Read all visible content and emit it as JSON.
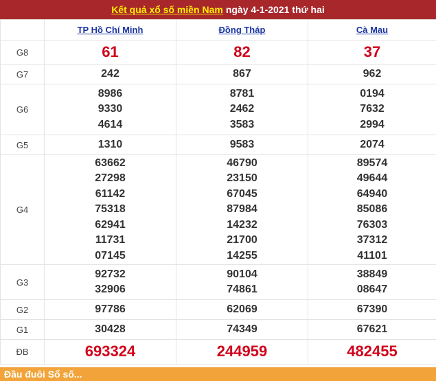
{
  "header": {
    "link": "Kết quả xổ số miền Nam",
    "date_text": "ngày 4-1-2021 thứ hai"
  },
  "provinces": [
    "TP Hồ Chí Minh",
    "Đồng Tháp",
    "Cà Mau"
  ],
  "prizes": [
    {
      "label": "G8",
      "values": [
        [
          "61"
        ],
        [
          "82"
        ],
        [
          "37"
        ]
      ]
    },
    {
      "label": "G7",
      "values": [
        [
          "242"
        ],
        [
          "867"
        ],
        [
          "962"
        ]
      ]
    },
    {
      "label": "G6",
      "values": [
        [
          "8986",
          "9330",
          "4614"
        ],
        [
          "8781",
          "2462",
          "3583"
        ],
        [
          "0194",
          "7632",
          "2994"
        ]
      ]
    },
    {
      "label": "G5",
      "values": [
        [
          "1310"
        ],
        [
          "9583"
        ],
        [
          "2074"
        ]
      ]
    },
    {
      "label": "G4",
      "values": [
        [
          "63662",
          "27298",
          "61142",
          "75318",
          "62941",
          "11731",
          "07145"
        ],
        [
          "46790",
          "23150",
          "67045",
          "87984",
          "14232",
          "21700",
          "14255"
        ],
        [
          "89574",
          "49644",
          "64940",
          "85086",
          "76303",
          "37312",
          "41101"
        ]
      ]
    },
    {
      "label": "G3",
      "values": [
        [
          "92732",
          "32906"
        ],
        [
          "90104",
          "74861"
        ],
        [
          "38849",
          "08647"
        ]
      ]
    },
    {
      "label": "G2",
      "values": [
        [
          "97786"
        ],
        [
          "62069"
        ],
        [
          "67390"
        ]
      ]
    },
    {
      "label": "G1",
      "values": [
        [
          "30428"
        ],
        [
          "74349"
        ],
        [
          "67621"
        ]
      ]
    },
    {
      "label": "ĐB",
      "values": [
        [
          "693324"
        ],
        [
          "244959"
        ],
        [
          "482455"
        ]
      ]
    }
  ],
  "footer": {
    "text": "Đầu đuôi Sổ số..."
  },
  "colors": {
    "header_bg": "#a8272b",
    "link_yellow": "#ffee00",
    "prize_red": "#d0021b",
    "province_blue": "#1a35a0",
    "footer_orange": "#f2a43a"
  }
}
